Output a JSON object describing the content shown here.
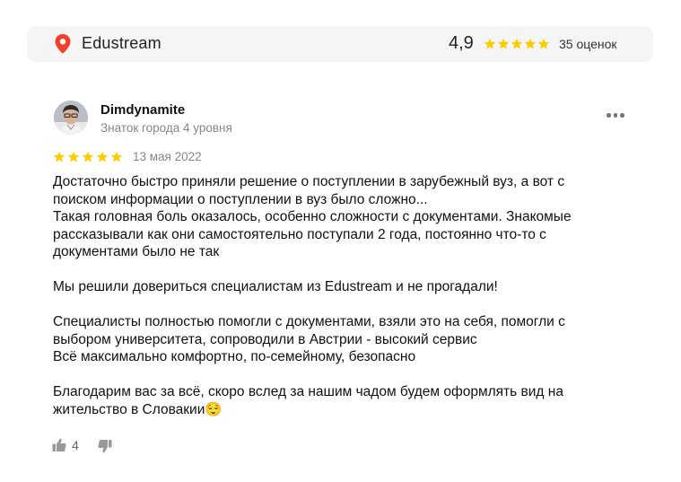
{
  "header": {
    "organization": "Edustream",
    "rating": "4,9",
    "stars": 5,
    "review_count": "35 оценок",
    "pin_color": "#f43f2a",
    "star_color": "#fc0"
  },
  "review": {
    "author": "Dimdynamite",
    "author_level": "Знаток города 4 уровня",
    "stars": 5,
    "date": "13 мая 2022",
    "lines": [
      "Достаточно быстро приняли решение о поступлении в зарубежный вуз, а вот с",
      "поиском информации о поступлении в вуз было сложно...",
      "Такая головная боль оказалось, особенно сложности с документами. Знакомые",
      "рассказывали как они самостоятельно поступали 2 года, постоянно что-то с",
      "документами было не так",
      "",
      "Мы решили довериться специалистам из Edustream и не прогадали!",
      "",
      "Специалисты полностью помогли с документами, взяли это на себя, помогли с",
      "выбором университета, сопроводили в Австрии - высокий сервис",
      "Всё максимально комфортно, по-семейному, безопасно",
      "",
      "Благодарим вас за всё, скоро вслед за нашим чадом будем оформлять вид на",
      "жительство в Словакии😌"
    ],
    "likes": "4"
  },
  "icons": {
    "location": "map-pin-icon",
    "star": "star-icon",
    "more": "more-dots-icon",
    "like": "thumbs-up-icon",
    "dislike": "thumbs-down-icon"
  }
}
